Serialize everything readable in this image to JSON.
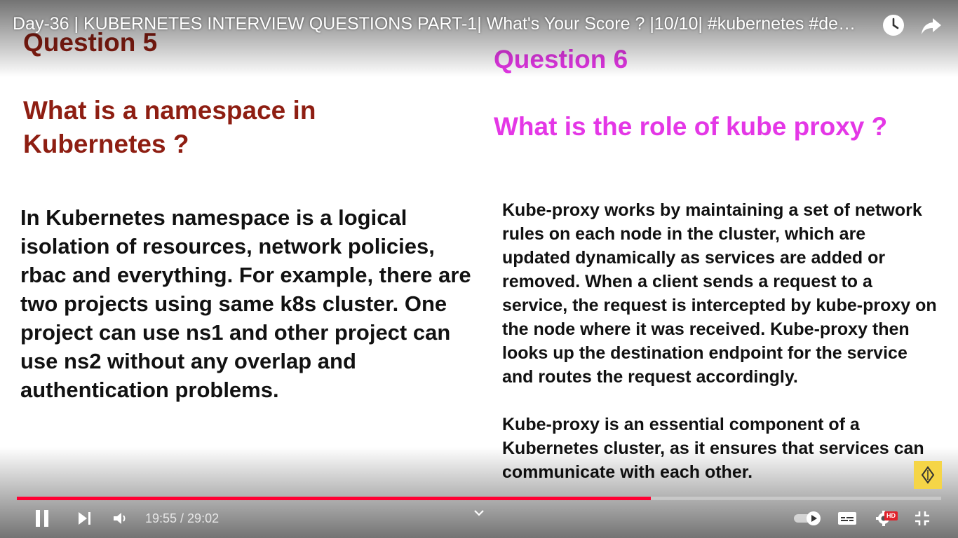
{
  "video": {
    "title": "Day-36 | KUBERNETES INTERVIEW QUESTIONS PART-1| What's Your Score ? |10/10| #kubernetes #de…",
    "time_display": "19:55 / 29:02",
    "progress_fraction": 0.686,
    "hd_label": "HD"
  },
  "slide": {
    "q5": {
      "heading": "Question 5",
      "question": "What is a namespace in Kubernetes ?",
      "answer": "In Kubernetes namespace is a logical isolation of resources, network policies, rbac and everything. For example, there are two projects using same k8s cluster. One project can use ns1 and other project can use ns2 without any overlap and authentication problems."
    },
    "q6": {
      "heading": "Question 6",
      "question": "What is the role of kube proxy ?",
      "answer_p1": "Kube-proxy works by maintaining a set of network rules on each node in the cluster, which are updated dynamically as services are added or removed. When a client sends a request to a service, the request is intercepted by kube-proxy on the node where it was received. Kube-proxy then looks up the destination endpoint for the service and routes the request accordingly.",
      "answer_p2": "Kube-proxy is an essential component of a Kubernetes cluster, as it ensures that services can communicate with each other."
    }
  },
  "colors": {
    "q5_accent": "#8e1e12",
    "q6_accent": "#e437e6",
    "progress": "#ff0033",
    "badge": "#f5d547"
  },
  "icons": {
    "top": [
      "watch-later-icon",
      "share-icon"
    ],
    "controls": [
      "pause-icon",
      "next-icon",
      "volume-icon",
      "chevron-up-icon",
      "autoplay-toggle-icon",
      "subtitles-icon",
      "settings-icon",
      "exit-fullscreen-icon"
    ]
  }
}
